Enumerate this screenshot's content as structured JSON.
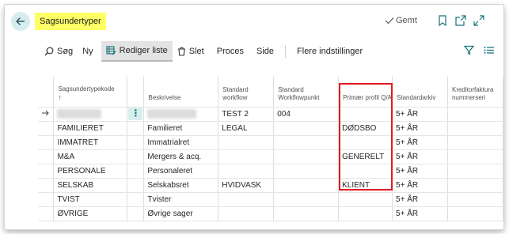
{
  "header": {
    "title": "Sagsundertyper",
    "saved_label": "Gemt"
  },
  "actions": {
    "search": "Søg",
    "new": "Ny",
    "edit_list": "Rediger liste",
    "delete": "Slet",
    "process": "Proces",
    "page": "Side",
    "more": "Flere indstillinger"
  },
  "table": {
    "columns": {
      "code": "Sagsundertypekode",
      "code_sort": "↑",
      "description": "Beskrivelse",
      "std_workflow": "Standard workflow",
      "std_workflowpoint": "Standard Workflowpunkt",
      "primary_profile": "Primær profil Q/A",
      "std_archive": "Standardarkiv",
      "creditor_invoice": "Kreditorfaktura nummerseri"
    },
    "rows": [
      {
        "code": "",
        "description": "",
        "workflow": "TEST 2",
        "workflowpoint": "004",
        "profile": "",
        "archive": "5+ ÅR",
        "creditor": ""
      },
      {
        "code": "FAMILIERET",
        "description": "Familieret",
        "workflow": "LEGAL",
        "workflowpoint": "",
        "profile": "DØDSBO",
        "archive": "5+ ÅR",
        "creditor": ""
      },
      {
        "code": "IMMATRET",
        "description": "Immatrialret",
        "workflow": "",
        "workflowpoint": "",
        "profile": "",
        "archive": "5+ ÅR",
        "creditor": ""
      },
      {
        "code": "M&A",
        "description": "Mergers & acq.",
        "workflow": "",
        "workflowpoint": "",
        "profile": "GENERELT",
        "archive": "5+ ÅR",
        "creditor": ""
      },
      {
        "code": "PERSONALE",
        "description": "Personaleret",
        "workflow": "",
        "workflowpoint": "",
        "profile": "",
        "archive": "5+ ÅR",
        "creditor": ""
      },
      {
        "code": "SELSKAB",
        "description": "Selskabsret",
        "workflow": "HVIDVASK",
        "workflowpoint": "",
        "profile": "KLIENT",
        "archive": "5+ ÅR",
        "creditor": ""
      },
      {
        "code": "TVIST",
        "description": "Tvister",
        "workflow": "",
        "workflowpoint": "",
        "profile": "",
        "archive": "5+ ÅR",
        "creditor": ""
      },
      {
        "code": "ØVRIGE",
        "description": "Øvrige sager",
        "workflow": "",
        "workflowpoint": "",
        "profile": "",
        "archive": "5+ ÅR",
        "creditor": ""
      }
    ]
  },
  "colors": {
    "title_highlight": "#ffff66",
    "accent": "#16737a",
    "annotation": "#e21b23"
  }
}
